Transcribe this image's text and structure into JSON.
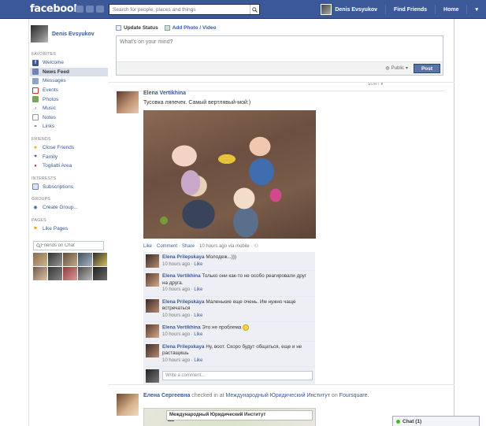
{
  "topbar": {
    "logo": "facebook",
    "search_placeholder": "Search for people, places and things",
    "user_name": "Denis Evsyukov",
    "find_friends": "Find Friends",
    "home": "Home"
  },
  "colors": {
    "brand": "#3b5998",
    "link": "#3b5998",
    "active_nav": "#d8dfea",
    "post_button": "#5b74a8"
  },
  "sidebar": {
    "profile_name": "Denis Evsyukov",
    "favorites_head": "FAVORITES",
    "favorites": [
      {
        "label": "Welcome",
        "icon": "facebook-icon"
      },
      {
        "label": "News Feed",
        "icon": "news-feed-icon"
      },
      {
        "label": "Messages",
        "icon": "messages-icon"
      },
      {
        "label": "Events",
        "icon": "events-icon"
      },
      {
        "label": "Photos",
        "icon": "photos-icon"
      },
      {
        "label": "Music",
        "icon": "music-icon"
      },
      {
        "label": "Notes",
        "icon": "notes-icon"
      },
      {
        "label": "Links",
        "icon": "links-icon"
      }
    ],
    "friends_head": "FRIENDS",
    "friends": [
      {
        "label": "Close Friends",
        "icon": "star-icon"
      },
      {
        "label": "Family",
        "icon": "family-icon"
      },
      {
        "label": "Togliatti Area",
        "icon": "location-icon"
      }
    ],
    "interests_head": "INTERESTS",
    "interests": [
      {
        "label": "Subscriptions",
        "icon": "subscriptions-icon"
      }
    ],
    "groups_head": "GROUPS",
    "groups": [
      {
        "label": "Create Group...",
        "icon": "group-icon"
      }
    ],
    "pages_head": "PAGES",
    "pages": [
      {
        "label": "Like Pages",
        "icon": "like-pages-icon"
      }
    ],
    "chat_search_placeholder": "Friends on Chat"
  },
  "composer": {
    "update_status": "Update Status",
    "add_photo": "Add Photo / Video",
    "placeholder": "What's on your mind?",
    "privacy": "Public",
    "post": "Post",
    "sort": "SORT"
  },
  "story1": {
    "author": "Elena Vertikhina",
    "message": "Тусовка ляпечек. Самый вертлявый-мой:)",
    "like": "Like",
    "comment": "Comment",
    "share": "Share",
    "meta": "10 hours ago via mobile",
    "comments": [
      {
        "author": "Elena Prilepskaya",
        "text": "Молодеж...)))",
        "time": "10 hours ago",
        "like": "Like"
      },
      {
        "author": "Elena Vertikhina",
        "text": "Только они как-то не особо реагировали друг на друга.",
        "time": "10 hours ago",
        "like": "Like"
      },
      {
        "author": "Elena Prilepskaya",
        "text": "Маленькие еще очень. Им нужно чаще встречаться",
        "time": "10 hours ago",
        "like": "Like"
      },
      {
        "author": "Elena Vertikhina",
        "text": "Это не проблема",
        "time": "10 hours ago",
        "like": "Like"
      },
      {
        "author": "Elena Prilepskaya",
        "text": "Ну, воот. Скоро будут общаться, еще и не растащишь",
        "time": "10 hours ago",
        "like": "Like"
      }
    ],
    "write_placeholder": "Write a comment..."
  },
  "story2": {
    "author": "Елена Сергеевна",
    "checked_in": "checked in at",
    "place": "Международный Юридический Институт",
    "on": "on",
    "app": "Foursquare.",
    "map_label": "Международный Юридический Институт"
  },
  "chat": {
    "label": "Chat (1)"
  }
}
